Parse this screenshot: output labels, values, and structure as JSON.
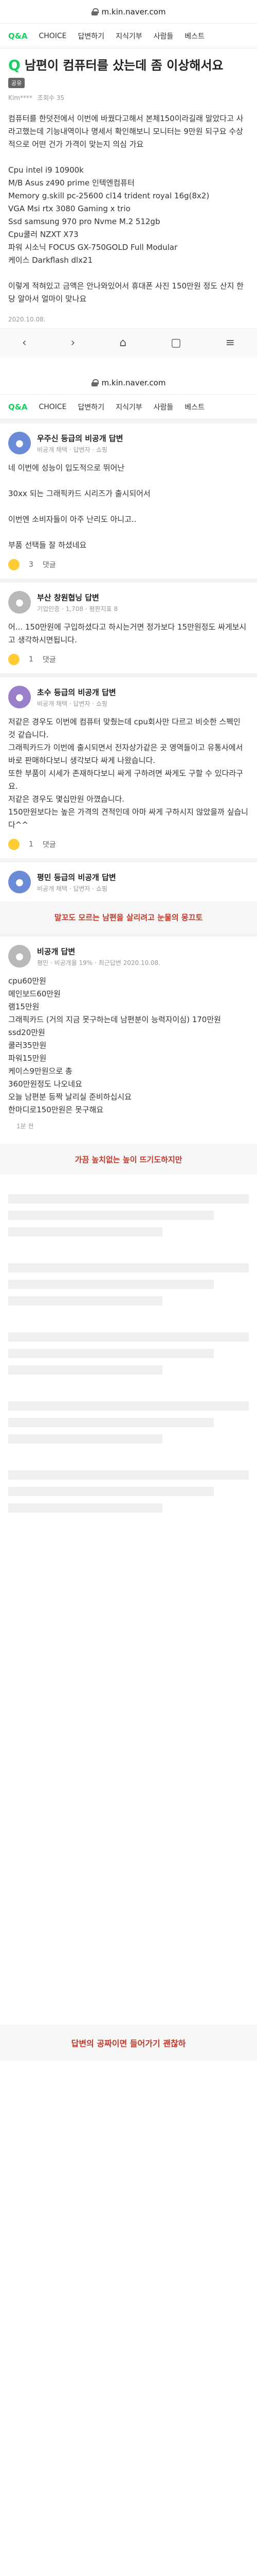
{
  "url": "m.kin.naver.com",
  "tabs": [
    "Q&A",
    "CHOICE",
    "답변하기",
    "지식기부",
    "사람들",
    "베스트"
  ],
  "question": {
    "badge": "Q",
    "title": "남편이 컴퓨터를 샀는데 좀 이상해서요",
    "tag": "공유",
    "meta": [
      "Kim****",
      "조회수 35"
    ],
    "body": "컴퓨터를 한덧전에서 이번에 바꿨다고해서 본체150이라길래 말았다고 사라고했는데 기능내역이나 명세서 확인해보니 모니터는 9만원 되구요 수상적으로 어떤 건가 가격이 맞는지 의심 가요\n\nCpu intel i9 10900k\nM/B Asus z490 prime 인텍엔컴퓨터\nMemory g.skill pc-25600 cl14 trident royal 16g(8x2)\nVGA Msi rtx 3080 Gaming x trio\nSsd samsung 970 pro Nvme M.2 512gb\nCpu쿨러 NZXT X73\n파워 시소닉 FOCUS GX-750GOLD Full Modular\n케이스 Darkflash dlx21\n\n이렇게 적혀있고 금액은 안나와있어서 휴대폰 사진 150만원 정도 산지 한당 알아서 얼마이 맞나요",
    "date": "2020.10.08."
  },
  "answers": [
    {
      "name": "우주신 등급의 비공개 답변",
      "sub": "비공개 채택 · 답변자 · 쇼핑",
      "body": "네 이번에 성능이 입도적으로 뛰어난\n\n30xx 되는 그래픽카드 시리즈가 출시되어서\n\n이번엔 소비자들이 아주 난리도 아니고..\n\n부품 선택들 잘 하셨네요",
      "reactions": [
        "3",
        "댓글"
      ]
    },
    {
      "name": "부산 창원협닝 답변",
      "sub": "기업인증 · 1,708 · 평판지표 8",
      "body": "어... 150만원에 구입하셨다고 하시는거면 정가보다 15만원정도 싸게보시고 생각하시면됩니다.",
      "reactions": [
        "1",
        "댓글"
      ]
    },
    {
      "name": "초수 등급의 비공개 답변",
      "sub": "비공개 채택 · 답변자 · 쇼핑",
      "body": "저같은 경우도 이번에 컴퓨터 맞췄는데 cpu회사만 다르고 비슷한 스펙인 것 같습니다.\n그래픽카드가 이번에 출시되면서 전자상가같은 곳 영역들이고 유통사에서 바로 판매하다보니 생각보다 싸게 나왔습니다.\n또한 부품이 시세가 존재하다보니 싸게 구하려면 싸게도 구할 수 있다라구요.\n저같은 경우도 몇십만원 아꼈습니다.\n150만원보다는 높은 가격의 견적인데 아마 싸게 구하시지 않았을까 싶습니다^^",
      "reactions": [
        "1",
        "댓글"
      ]
    },
    {
      "name": "평민 등급의 비공개 답변",
      "sub": "비공개 채택 · 답변자 · 쇼핑",
      "body": "",
      "reactions": []
    }
  ],
  "banner1": "말꼬도 모르는 남편을 살리려고 눈물의 몽끄토",
  "detail": {
    "name": "비공개 답변",
    "sub": "평민 · 비공개율 19% · 최근답변 2020.10.08.",
    "body": "cpu60만원\n메인보드60만원\n램15만원\n그래픽카드 (거의 지금 못구하는데 남편분이 능력자이심) 170만원\nssd20만원\n쿨러35만원\n파워15만원\n케이스9만원으로 총\n360만원정도 나오네요\n오늘 남편분 등짝 날리실 준비하십시요\n한마디로150만원은 못구해요",
    "footer": "1분 전"
  },
  "banner2": "가끔 높치없는 높이 뜨기도하지만",
  "footer": "답변의 공짜이면 들어가기 괜찮하"
}
